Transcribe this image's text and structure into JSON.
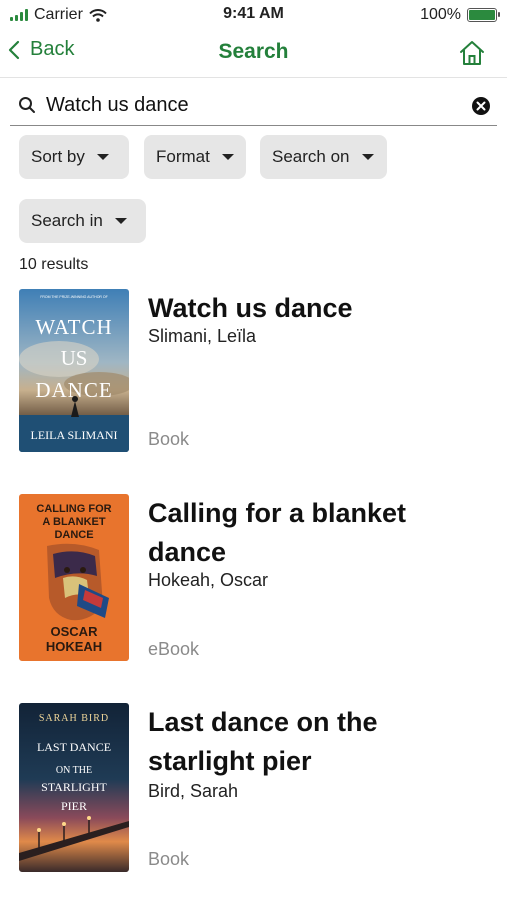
{
  "status": {
    "carrier": "Carrier",
    "time": "9:41 AM",
    "battery": "100%",
    "battery_level": 1.0,
    "accent": "#2b8a3e"
  },
  "nav": {
    "back_label": "Back",
    "title": "Search",
    "color": "#24803b"
  },
  "search": {
    "value": "Watch us dance",
    "placeholder": ""
  },
  "filters": {
    "sort_by": "Sort by",
    "format": "Format",
    "search_on": "Search on",
    "search_in": "Search in"
  },
  "results_count": "10 results",
  "results": [
    {
      "title": "Watch us dance",
      "author": "Slimani, Leïla",
      "format": "Book",
      "cover": {
        "top_text": "FROM THE PRIZE-WINNING AUTHOR OF",
        "title_lines": [
          "WATCH",
          "US",
          "DANCE"
        ],
        "author_text": "LEILA SLIMANI"
      }
    },
    {
      "title": "Calling for a blanket dance",
      "author": "Hokeah, Oscar",
      "format": "eBook",
      "cover": {
        "title_lines": [
          "CALLING FOR",
          "A BLANKET",
          "DANCE"
        ],
        "author_lines": [
          "OSCAR",
          "HOKEAH"
        ]
      }
    },
    {
      "title": "Last dance on the starlight pier",
      "author": "Bird, Sarah",
      "format": "Book",
      "cover": {
        "author_text": "SARAH BIRD",
        "title_lines": [
          "LAST DANCE",
          "ON THE",
          "STARLIGHT",
          "PIER"
        ]
      }
    }
  ]
}
